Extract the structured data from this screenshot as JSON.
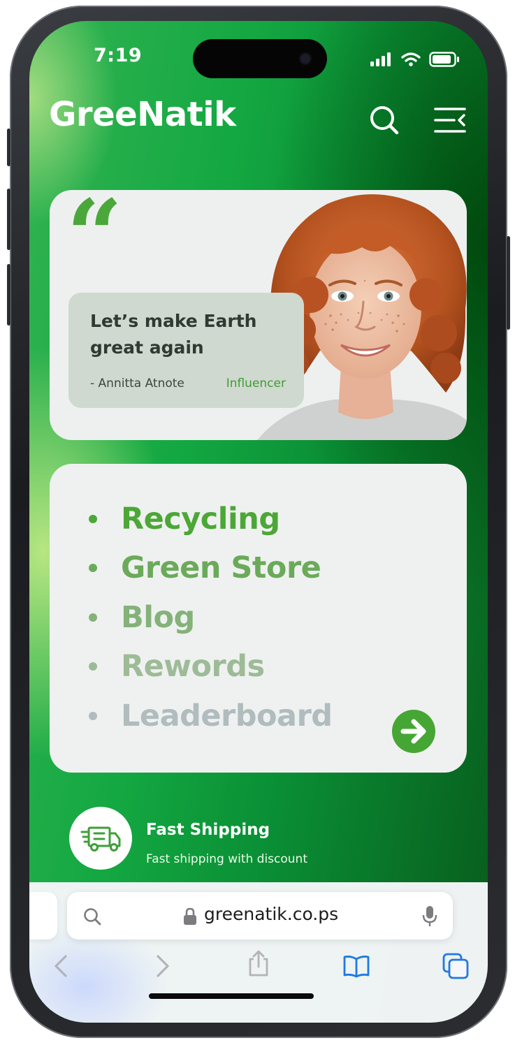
{
  "status_bar": {
    "time": "7:19"
  },
  "header": {
    "brand": "GreeNatik",
    "search_icon": "search-icon",
    "menu_icon": "menu-collapse-icon"
  },
  "quote_card": {
    "quote": "Let’s make Earth great again",
    "author": "- Annitta Atnote",
    "role": "Influencer",
    "accent": "#4aa83a"
  },
  "menu": {
    "items": [
      {
        "label": "Recycling",
        "color": "#4ca737"
      },
      {
        "label": "Green Store",
        "color": "#6aaa5a"
      },
      {
        "label": "Blog",
        "color": "#84b27a"
      },
      {
        "label": "Rewords",
        "color": "#9dbb97"
      },
      {
        "label": "Leaderboard",
        "color": "#b0bcbd"
      }
    ],
    "next_icon": "arrow-right-icon"
  },
  "shipping": {
    "title": "Fast Shipping",
    "subtitle": "Fast shipping with discount",
    "icon": "truck-icon"
  },
  "browser": {
    "url": "greenatik.co.ps"
  }
}
